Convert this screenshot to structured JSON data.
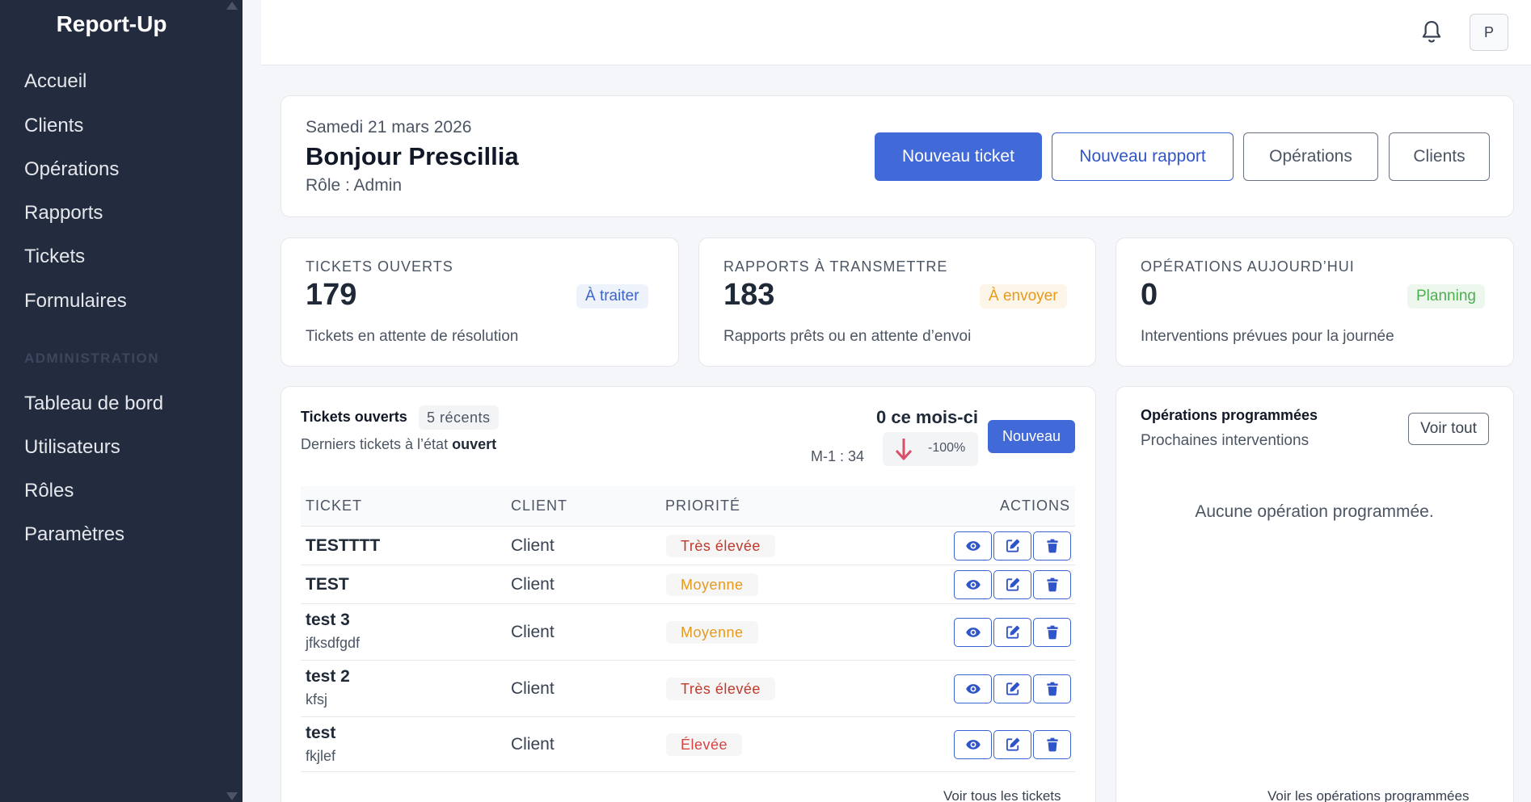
{
  "app": {
    "brand": "Report-Up"
  },
  "sidebar": {
    "items": [
      {
        "label": "Accueil"
      },
      {
        "label": "Clients"
      },
      {
        "label": "Opérations"
      },
      {
        "label": "Rapports"
      },
      {
        "label": "Tickets"
      },
      {
        "label": "Formulaires"
      }
    ],
    "admin_section": "ADMINISTRATION",
    "admin_items": [
      {
        "label": "Tableau de bord"
      },
      {
        "label": "Utilisateurs"
      },
      {
        "label": "Rôles"
      },
      {
        "label": "Paramètres"
      }
    ]
  },
  "topbar": {
    "avatar_initial": "P",
    "bell_icon": "bell-icon"
  },
  "welcome": {
    "date": "Samedi 21 mars 2026",
    "greeting": "Bonjour Prescillia",
    "role": "Rôle : Admin",
    "buttons": {
      "new_ticket": "Nouveau ticket",
      "new_report": "Nouveau rapport",
      "operations": "Opérations",
      "clients": "Clients"
    }
  },
  "stats": [
    {
      "title": "TICKETS OUVERTS",
      "value": "179",
      "badge": "À traiter",
      "desc": "Tickets en attente de résolution",
      "badge_color": "#3b63c9",
      "badge_bg": "#eef2fb"
    },
    {
      "title": "RAPPORTS À TRANSMETTRE",
      "value": "183",
      "badge": "À envoyer",
      "desc": "Rapports prêts ou en attente d’envoi",
      "badge_color": "#e69a1a",
      "badge_bg": "#fdf5e8"
    },
    {
      "title": "OPÉRATIONS AUJOURD’HUI",
      "value": "0",
      "badge": "Planning",
      "desc": "Interventions prévues pour la journée",
      "badge_color": "#4caf50",
      "badge_bg": "#eef7ee"
    }
  ],
  "tickets": {
    "title": "Tickets ouverts",
    "recent": "5 récents",
    "subtitle_prefix": "Derniers tickets à l’état",
    "subtitle_state": "ouvert",
    "month": "0 ce mois-ci",
    "m1": "M-1 : 34",
    "delta": "-100%",
    "new_button": "Nouveau",
    "columns": {
      "ticket": "TICKET",
      "client": "CLIENT",
      "priority": "PRIORITÉ",
      "actions": "ACTIONS"
    },
    "rows": [
      {
        "name": "TESTTTT",
        "desc": "",
        "client": "Client",
        "priority": "Très élevée",
        "priority_color": "#c0392b"
      },
      {
        "name": "TEST",
        "desc": "",
        "client": "Client",
        "priority": "Moyenne",
        "priority_color": "#e69a1a"
      },
      {
        "name": "test 3",
        "desc": "jfksdfgdf",
        "client": "Client",
        "priority": "Moyenne",
        "priority_color": "#e69a1a"
      },
      {
        "name": "test 2",
        "desc": "kfsj",
        "client": "Client",
        "priority": "Très élevée",
        "priority_color": "#c0392b"
      },
      {
        "name": "test",
        "desc": "fkjlef",
        "client": "Client",
        "priority": "Élevée",
        "priority_color": "#d64541"
      }
    ],
    "footer_link": "Voir tous les tickets"
  },
  "operations": {
    "title": "Opérations programmées",
    "subtitle": "Prochaines interventions",
    "view_all": "Voir tout",
    "empty": "Aucune opération programmée.",
    "footer_link": "Voir les opérations programmées"
  },
  "colors": {
    "accent": "#4169d8",
    "sidebar_bg": "#232b3e",
    "delta_arrow": "#d94f6a"
  }
}
